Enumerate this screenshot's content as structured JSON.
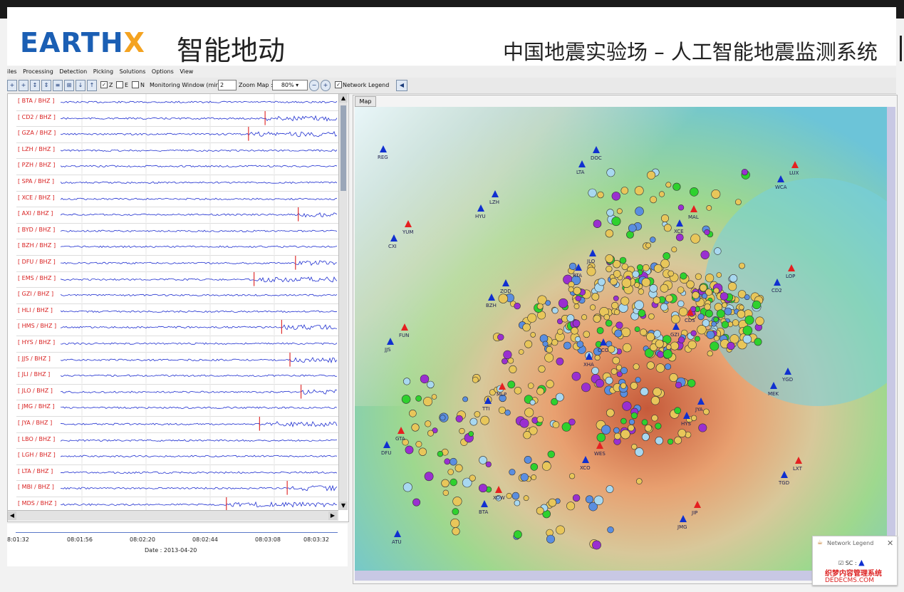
{
  "banner": {
    "logo": "EARTHX",
    "brand_cn": "智能地动",
    "system_title": "中国地震实验场 – 人工智能地震监测系统"
  },
  "menu": [
    "iles",
    "Processing",
    "Detection",
    "Picking",
    "Solutions",
    "Options",
    "View"
  ],
  "toolbar": {
    "check_z": "Z",
    "check_e": "E",
    "check_n": "N",
    "monitoring_label": "Monitoring Window (min)",
    "monitoring_value": "2",
    "zoom_label": "Zoom Map :",
    "zoom_value": "80%",
    "network_legend_label": "Network Legend"
  },
  "channels": [
    {
      "label": "[ BTA / BHZ ]",
      "pick": null
    },
    {
      "label": "[ CD2 / BHZ ]",
      "pick": 0.74
    },
    {
      "label": "[ GZA / BHZ ]",
      "pick": 0.68
    },
    {
      "label": "[ LZH / BHZ ]",
      "pick": null
    },
    {
      "label": "[ PZH / BHZ ]",
      "pick": null
    },
    {
      "label": "[ SPA / BHZ ]",
      "pick": null
    },
    {
      "label": "[ XCE / BHZ ]",
      "pick": null
    },
    {
      "label": "[ AXI / BHZ ]",
      "pick": 0.86
    },
    {
      "label": "[ BYD / BHZ ]",
      "pick": null
    },
    {
      "label": "[ BZH / BHZ ]",
      "pick": null
    },
    {
      "label": "[ DFU / BHZ ]",
      "pick": 0.85
    },
    {
      "label": "[ EMS / BHZ ]",
      "pick": 0.7
    },
    {
      "label": "[ GZI / BHZ ]",
      "pick": null
    },
    {
      "label": "[ HLI / BHZ ]",
      "pick": null
    },
    {
      "label": "[ HMS / BHZ ]",
      "pick": 0.8
    },
    {
      "label": "[ HYS / BHZ ]",
      "pick": null
    },
    {
      "label": "[ JJS / BHZ ]",
      "pick": 0.83
    },
    {
      "label": "[ JLI / BHZ ]",
      "pick": null
    },
    {
      "label": "[ JLO / BHZ ]",
      "pick": 0.87
    },
    {
      "label": "[ JMG / BHZ ]",
      "pick": null
    },
    {
      "label": "[ JYA / BHZ ]",
      "pick": 0.72
    },
    {
      "label": "[ LBO / BHZ ]",
      "pick": null
    },
    {
      "label": "[ LGH / BHZ ]",
      "pick": null
    },
    {
      "label": "[ LTA / BHZ ]",
      "pick": null
    },
    {
      "label": "[ MBI / BHZ ]",
      "pick": 0.82
    },
    {
      "label": "[ MDS / BHZ ]",
      "pick": 0.6
    }
  ],
  "time_axis": {
    "ticks": [
      "8:01:32",
      "08:01:56",
      "08:02:20",
      "08:02:44",
      "08:03:08",
      "08:03:32"
    ],
    "date": "Date : 2013-04-20"
  },
  "map": {
    "tab": "Map",
    "stations": [
      {
        "code": "REG",
        "color": "blue"
      },
      {
        "code": "HYU",
        "color": "blue"
      },
      {
        "code": "RTA",
        "color": "blue"
      },
      {
        "code": "GZI",
        "color": "blue"
      },
      {
        "code": "MEK",
        "color": "blue"
      },
      {
        "code": "DFU",
        "color": "blue"
      },
      {
        "code": "BTA",
        "color": "blue"
      },
      {
        "code": "LTA",
        "color": "blue"
      },
      {
        "code": "XCE",
        "color": "blue"
      },
      {
        "code": "CD2",
        "color": "blue"
      },
      {
        "code": "JJS",
        "color": "blue"
      },
      {
        "code": "TTI",
        "color": "blue"
      },
      {
        "code": "XCO",
        "color": "blue"
      },
      {
        "code": "JMG",
        "color": "blue"
      },
      {
        "code": "WCA",
        "color": "blue"
      },
      {
        "code": "CXI",
        "color": "blue"
      },
      {
        "code": "BZH",
        "color": "blue"
      },
      {
        "code": "XHA",
        "color": "blue"
      },
      {
        "code": "HYS",
        "color": "blue"
      },
      {
        "code": "TGD",
        "color": "blue"
      },
      {
        "code": "ATU",
        "color": "blue"
      },
      {
        "code": "LZH",
        "color": "blue"
      },
      {
        "code": "JLO",
        "color": "blue"
      },
      {
        "code": "CDS",
        "color": "red"
      },
      {
        "code": "YGD",
        "color": "blue"
      },
      {
        "code": "GTA",
        "color": "red"
      },
      {
        "code": "XOW",
        "color": "red"
      },
      {
        "code": "DOC",
        "color": "blue"
      },
      {
        "code": "MAL",
        "color": "red"
      },
      {
        "code": "LOP",
        "color": "red"
      },
      {
        "code": "FUN",
        "color": "red"
      },
      {
        "code": "MLP",
        "color": "red"
      },
      {
        "code": "WES",
        "color": "red"
      },
      {
        "code": "JIP",
        "color": "red"
      },
      {
        "code": "LUX",
        "color": "red"
      },
      {
        "code": "YUM",
        "color": "red"
      },
      {
        "code": "ZOD",
        "color": "blue"
      },
      {
        "code": "CCO",
        "color": "blue"
      },
      {
        "code": "JYA",
        "color": "blue"
      },
      {
        "code": "LXT",
        "color": "red"
      }
    ]
  },
  "legend": {
    "title": "Network Legend",
    "item_label": "SC :"
  },
  "watermark": {
    "line1": "织梦内容管理系统",
    "line2": "DEDECMS.COM"
  },
  "colors": {
    "trace": "#1f2fd0",
    "pick": "#e03030",
    "label_red": "#d81e1e",
    "logo_blue": "#1b5fb4",
    "logo_orange": "#f4a321"
  }
}
